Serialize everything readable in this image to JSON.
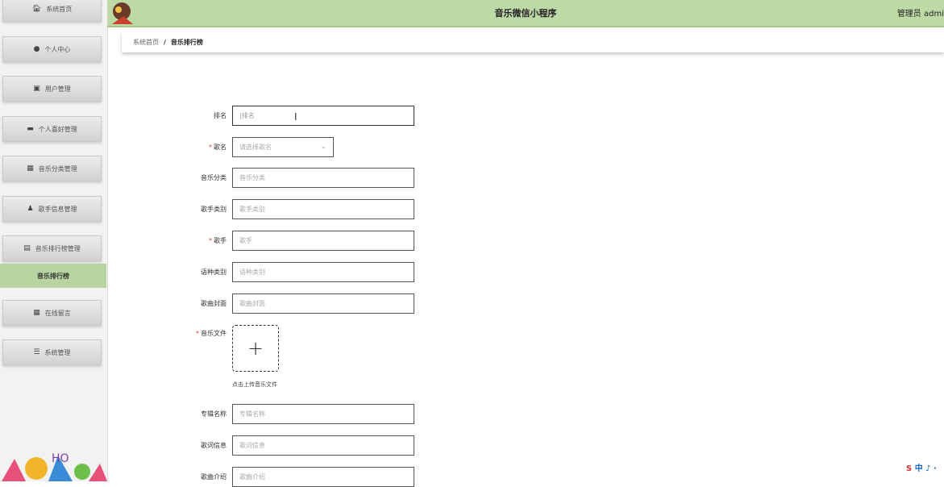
{
  "header": {
    "title": "音乐微信小程序",
    "admin": "管理员 admi"
  },
  "sidebar": {
    "items": [
      {
        "label": "系统首页",
        "icon": "home-icon",
        "glyph": "🏠︎"
      },
      {
        "label": "个人中心",
        "icon": "person-icon",
        "glyph": "●"
      },
      {
        "label": "用户管理",
        "icon": "user-group-icon",
        "glyph": "▣"
      },
      {
        "label": "个人喜好管理",
        "icon": "chat-icon",
        "glyph": "▬"
      },
      {
        "label": "音乐分类管理",
        "icon": "grid-icon",
        "glyph": "▦"
      },
      {
        "label": "歌手信息管理",
        "icon": "singer-icon",
        "glyph": "♟"
      },
      {
        "label": "音乐排行榜管理",
        "icon": "list-icon",
        "glyph": "▤"
      },
      {
        "label": "音乐排行榜",
        "active": true
      },
      {
        "label": "在线留言",
        "icon": "grid-icon",
        "glyph": "▦"
      },
      {
        "label": "系统管理",
        "icon": "settings-icon",
        "glyph": "☰"
      }
    ]
  },
  "breadcrumb": {
    "home": "系统首页",
    "separator": "/",
    "current": "音乐排行榜"
  },
  "form": {
    "rank": {
      "label": "排名",
      "placeholder": "排名"
    },
    "song": {
      "label": "歌名",
      "placeholder": "请选择歌名",
      "required": "*"
    },
    "category": {
      "label": "音乐分类",
      "placeholder": "音乐分类"
    },
    "singer_type": {
      "label": "歌手类别",
      "placeholder": "歌手类别"
    },
    "singer": {
      "label": "歌手",
      "placeholder": "歌手",
      "required": "*"
    },
    "language": {
      "label": "语种类别",
      "placeholder": "语种类别"
    },
    "cover": {
      "label": "歌曲封面",
      "placeholder": "歌曲封面"
    },
    "music_file": {
      "label": "音乐文件",
      "required": "*",
      "plus": "+",
      "hint": "点击上传音乐文件"
    },
    "album": {
      "label": "专辑名称",
      "placeholder": "专辑名称"
    },
    "lyrics": {
      "label": "歌词信息",
      "placeholder": "歌词信息"
    },
    "intro": {
      "label": "歌曲介绍",
      "placeholder": "歌曲介绍"
    }
  },
  "ime": {
    "s": "S",
    "rest": "中 ♪ ·"
  },
  "colors": {
    "accent": "#bcd9a6",
    "active": "#b8d4a0",
    "required": "#e53935"
  }
}
